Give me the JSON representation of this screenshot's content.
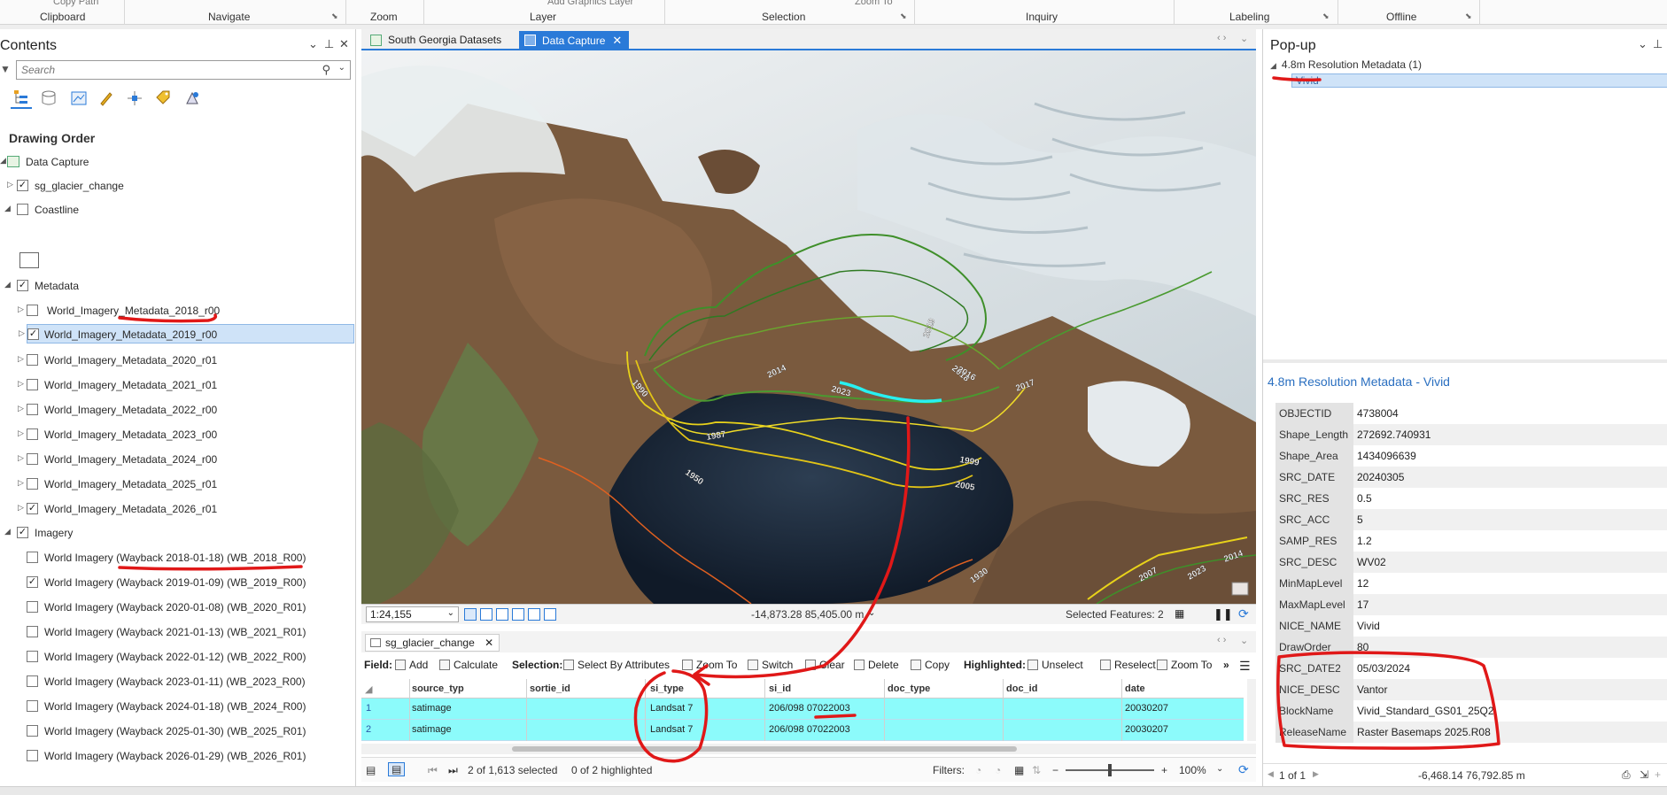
{
  "ribbon": {
    "groups": [
      "Clipboard",
      "Navigate",
      "Zoom",
      "Layer",
      "Selection",
      "Inquiry",
      "Labeling",
      "Offline"
    ],
    "faded_items": [
      "Copy Path",
      "Add Graphics Layer",
      "Zoom To"
    ]
  },
  "contents": {
    "title": "Contents",
    "search_placeholder": "Search",
    "section": "Drawing Order",
    "map_name": "Data Capture",
    "layers": {
      "glacier": "sg_glacier_change",
      "coastline": "Coastline",
      "metadata": "Metadata",
      "imagery": "Imagery"
    },
    "metadata_items": [
      "World_Imagery_Metadata_2018_r00",
      "World_Imagery_Metadata_2019_r00",
      "World_Imagery_Metadata_2020_r01",
      "World_Imagery_Metadata_2021_r01",
      "World_Imagery_Metadata_2022_r00",
      "World_Imagery_Metadata_2023_r00",
      "World_Imagery_Metadata_2024_r00",
      "World_Imagery_Metadata_2025_r01",
      "World_Imagery_Metadata_2026_r01"
    ],
    "imagery_items": [
      "World Imagery (Wayback 2018-01-18) (WB_2018_R00)",
      "World Imagery (Wayback 2019-01-09) (WB_2019_R00)",
      "World Imagery (Wayback 2020-01-08) (WB_2020_R01)",
      "World Imagery (Wayback 2021-01-13) (WB_2021_R01)",
      "World Imagery (Wayback 2022-01-12) (WB_2022_R00)",
      "World Imagery (Wayback 2023-01-11) (WB_2023_R00)",
      "World Imagery (Wayback 2024-01-18) (WB_2024_R00)",
      "World Imagery (Wayback 2025-01-30) (WB_2025_R01)",
      "World Imagery (Wayback 2026-01-29) (WB_2026_R01)"
    ]
  },
  "map": {
    "tabs": [
      "South Georgia Datasets",
      "Data Capture"
    ],
    "active_tab": "Data Capture",
    "scale": "1:24,155",
    "coordinates": "-14,873.28 85,405.00 m",
    "selected_features": "Selected Features: 2",
    "year_labels": [
      "2014",
      "2019",
      "2018",
      "2016",
      "2017",
      "2023",
      "1987",
      "1999",
      "2005",
      "1950",
      "1930",
      "1990",
      "2007",
      "2023",
      "2014"
    ]
  },
  "table": {
    "tab": "sg_glacier_change",
    "toolbar": {
      "field": "Field:",
      "add": "Add",
      "calculate": "Calculate",
      "selection": "Selection:",
      "select_by_attributes": "Select By Attributes",
      "zoom_to": "Zoom To",
      "switch": "Switch",
      "clear": "Clear",
      "delete": "Delete",
      "copy": "Copy",
      "highlighted": "Highlighted:",
      "unselect": "Unselect",
      "reselect": "Reselect",
      "zoom_to_2": "Zoom To"
    },
    "columns": [
      "source_typ",
      "sortie_id",
      "si_type",
      "si_id",
      "doc_type",
      "doc_id",
      "date"
    ],
    "rows": [
      {
        "n": "1",
        "source_typ": "satimage",
        "sortie_id": "",
        "si_type": "Landsat 7",
        "si_id": "206/098 07022003",
        "doc_type": "",
        "doc_id": "",
        "date": "20030207"
      },
      {
        "n": "2",
        "source_typ": "satimage",
        "sortie_id": "",
        "si_type": "Landsat 7",
        "si_id": "206/098 07022003",
        "doc_type": "",
        "doc_id": "",
        "date": "20030207"
      }
    ],
    "status": {
      "selected": "2 of 1,613 selected",
      "highlighted": "0 of 2 highlighted",
      "filters": "Filters:",
      "zoom": "100%",
      "zoom_level": 0.5
    }
  },
  "popup": {
    "title": "Pop-up",
    "layer_node": "4.8m Resolution Metadata (1)",
    "feature_node": "Vivid",
    "detail_title": "4.8m Resolution Metadata - Vivid",
    "fields": [
      {
        "k": "OBJECTID",
        "v": "4738004"
      },
      {
        "k": "Shape_Length",
        "v": "272692.740931"
      },
      {
        "k": "Shape_Area",
        "v": "1434096639"
      },
      {
        "k": "SRC_DATE",
        "v": "20240305"
      },
      {
        "k": "SRC_RES",
        "v": "0.5"
      },
      {
        "k": "SRC_ACC",
        "v": "5"
      },
      {
        "k": "SAMP_RES",
        "v": "1.2"
      },
      {
        "k": "SRC_DESC",
        "v": "WV02"
      },
      {
        "k": "MinMapLevel",
        "v": "12"
      },
      {
        "k": "MaxMapLevel",
        "v": "17"
      },
      {
        "k": "NICE_NAME",
        "v": "Vivid"
      },
      {
        "k": "DrawOrder",
        "v": "80"
      },
      {
        "k": "SRC_DATE2",
        "v": "05/03/2024"
      },
      {
        "k": "NICE_DESC",
        "v": "Vantor"
      },
      {
        "k": "BlockName",
        "v": "Vivid_Standard_GS01_25Q2"
      },
      {
        "k": "ReleaseName",
        "v": "Raster Basemaps 2025.R08"
      }
    ],
    "footer_nav": "1 of 1",
    "footer_coord": "-6,468.14 76,792.85 m"
  },
  "colors": {
    "accent": "#2a7ad8",
    "selection_row": "#8cfbfb",
    "annotation_red": "#e01818",
    "glacier_green": "#3f8f2a",
    "glacier_yellow": "#e8d21a",
    "glacier_cyan": "#28f0f0"
  }
}
